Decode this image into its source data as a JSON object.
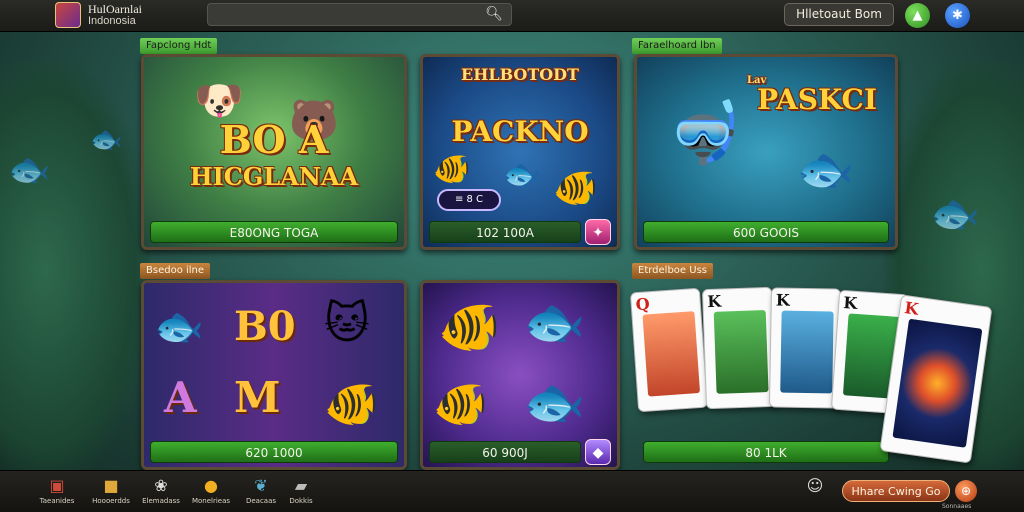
{
  "header": {
    "brand_title": "HulOarnlai",
    "brand_subtitle": "Indonosia",
    "search_icon": "search-icon",
    "login_label": "Hlletoaut Bom",
    "green_button_icon": "up-arrow-icon",
    "blue_button_icon": "bluetooth-icon"
  },
  "sections": [
    {
      "label": "Fapclong Hdt"
    },
    {
      "label": "Faraelhoard lbn"
    },
    {
      "label": "Bsedoo ilne"
    },
    {
      "label": "Etrdelboe Uss"
    }
  ],
  "tiles": [
    {
      "title_top": "BO A",
      "title_bottom": "HICGLANAA",
      "bar": "E80ONG TOGA"
    },
    {
      "title_top": "EHLBOTODT",
      "title_bottom": "PACKNO",
      "pill": "≡ 8 C",
      "bar": "102 100A"
    },
    {
      "title": "PASKCI",
      "title_small": "Lav",
      "bar": "600 GOOIS"
    },
    {
      "bar": "620 1000"
    },
    {
      "bar": "60 900J"
    },
    {
      "bar": "80 1LK"
    }
  ],
  "cards": [
    {
      "rank": "Q"
    },
    {
      "rank": "K"
    },
    {
      "rank": "K"
    },
    {
      "rank": "K"
    },
    {
      "rank": "K"
    }
  ],
  "bottom_nav": [
    {
      "label": "Taeanides",
      "icon": "gift-icon"
    },
    {
      "label": "Hoooerdds",
      "icon": "treasure-icon"
    },
    {
      "label": "Elemadass",
      "icon": "paw-icon"
    },
    {
      "label": "Monelrieas",
      "icon": "coin-icon"
    },
    {
      "label": "Deacaas",
      "icon": "fish-icon"
    },
    {
      "label": "Dokkis",
      "icon": "chest-icon"
    }
  ],
  "profile_icon": "user-icon",
  "cta": {
    "label": "Hhare Cwing Go",
    "sub": "Sonnaaes"
  }
}
